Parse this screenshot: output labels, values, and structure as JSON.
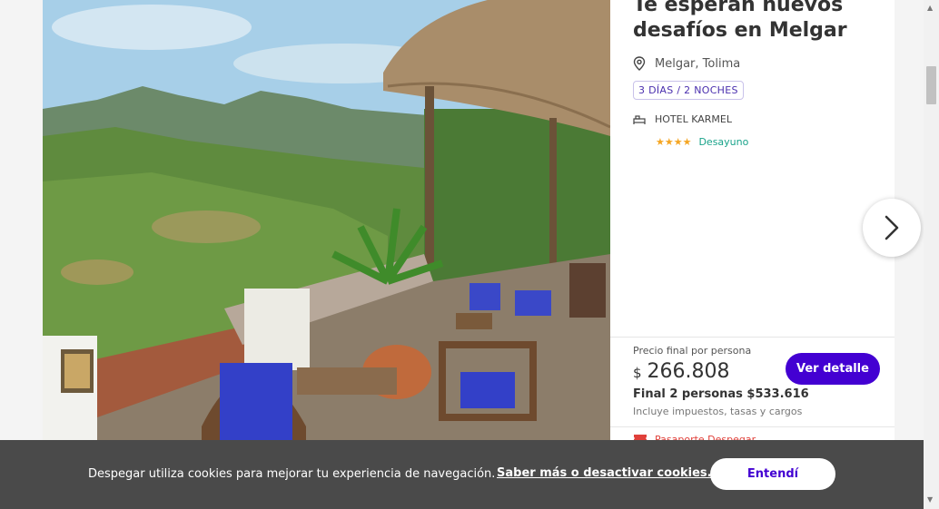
{
  "card": {
    "title": "Te esperan nuevos desafíos en Melgar",
    "location": "Melgar, Tolima",
    "duration": "3 DÍAS / 2 NOCHES",
    "hotel_name": "HOTEL KARMEL",
    "stars": "★★★★",
    "rating": 4,
    "meal": "Desayuno",
    "price_label": "Precio final por persona",
    "currency": "$",
    "price": "266.808",
    "final_price": "Final 2 personas $533.616",
    "taxes_note": "Incluye impuestos, tasas y cargos",
    "cta_label": "Ver detalle",
    "passport": "Pasaporte Despegar"
  },
  "icons": {
    "location": "map-pin-icon",
    "hotel": "bed-icon",
    "next": "chevron-right-icon",
    "passport": "ticket-icon"
  },
  "cookie_banner": {
    "message": "Despegar utiliza cookies para mejorar tu experiencia de navegación.",
    "link": "Saber más o desactivar cookies.",
    "accept": "Entendí"
  },
  "colors": {
    "brand_purple": "#4300d2",
    "star": "#f5a623",
    "meal_green": "#19a38a",
    "banner_bg": "#4a4a4a"
  }
}
